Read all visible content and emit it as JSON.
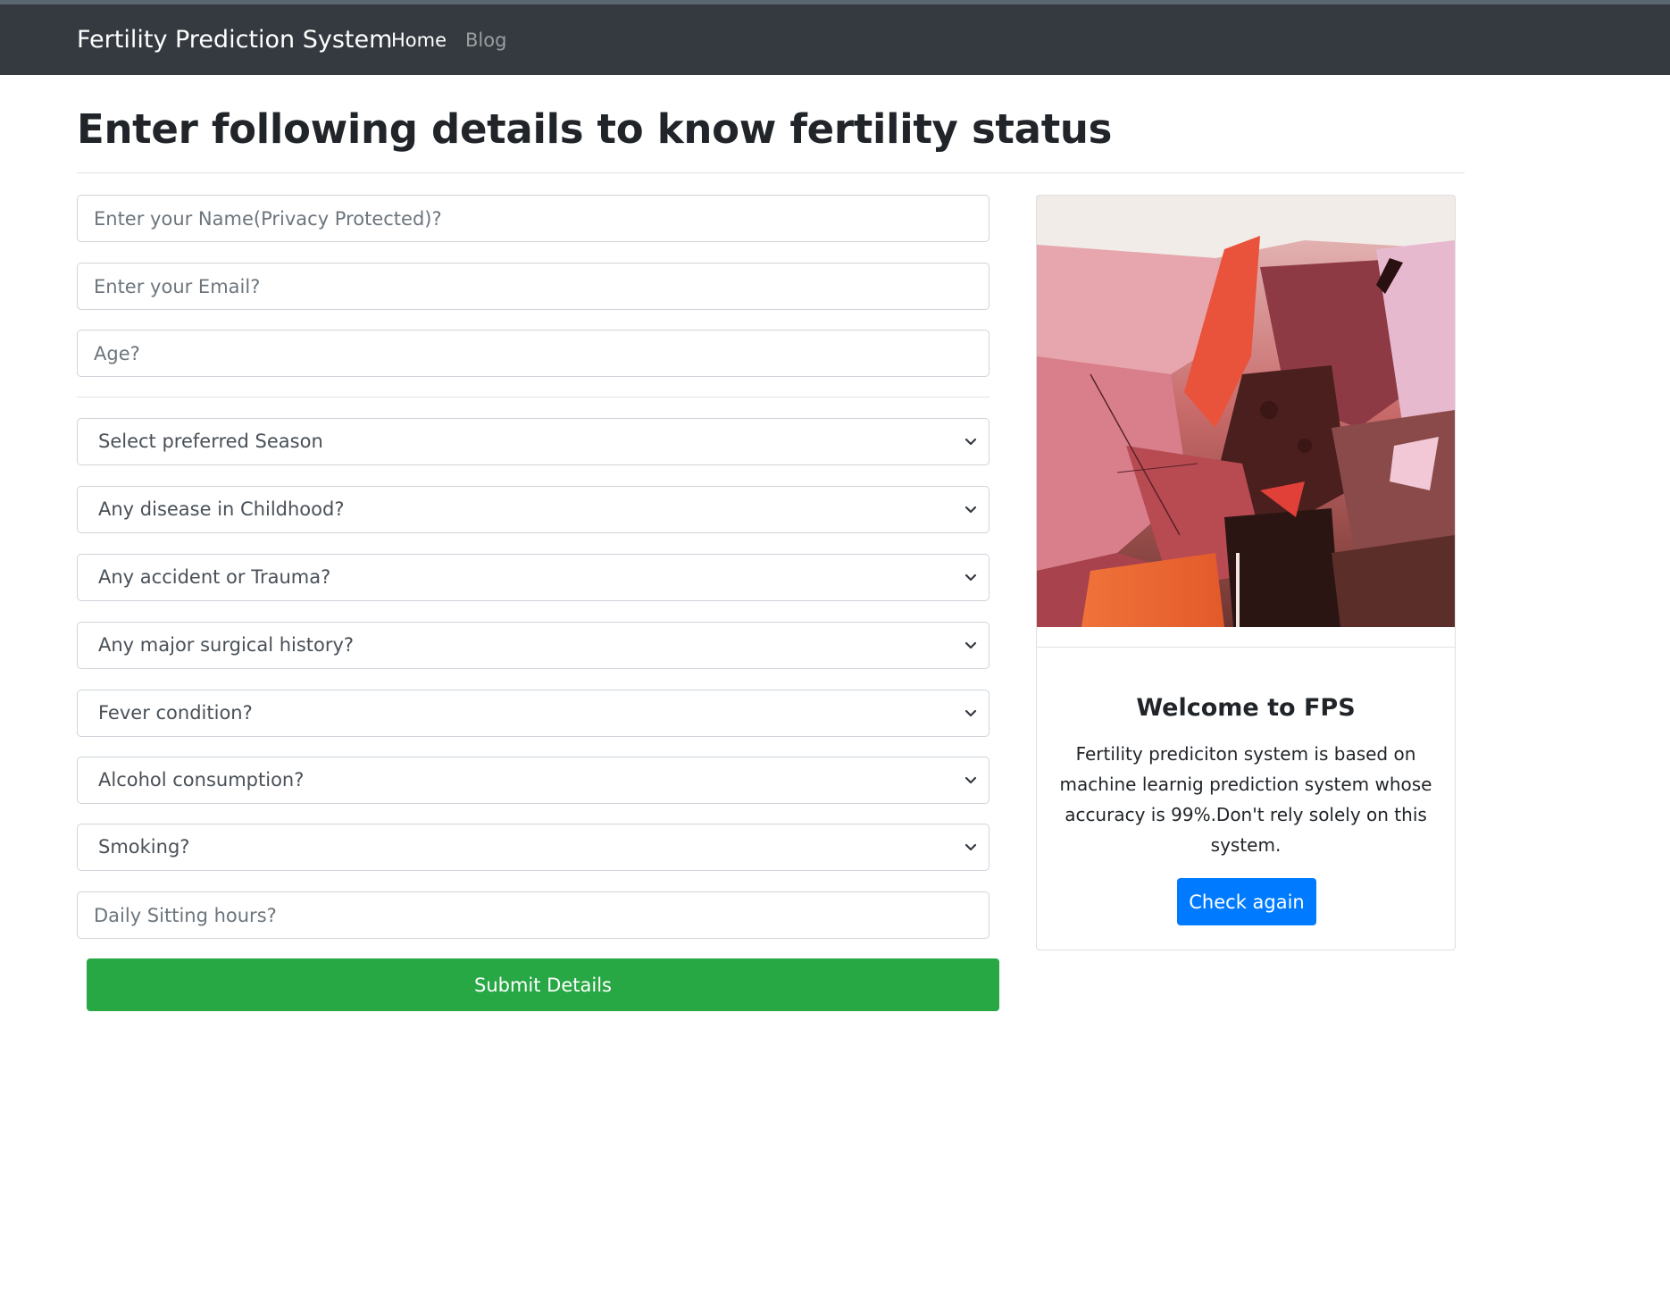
{
  "navbar": {
    "brand": "Fertility Prediction System",
    "links": [
      {
        "label": "Home"
      },
      {
        "label": "Blog"
      }
    ]
  },
  "page": {
    "heading": "Enter following details to know fertility status"
  },
  "form": {
    "name_placeholder": "Enter your Name(Privacy Protected)?",
    "email_placeholder": "Enter your Email?",
    "age_placeholder": "Age?",
    "selects": [
      {
        "label": "Select preferred Season"
      },
      {
        "label": "Any disease in Childhood?"
      },
      {
        "label": "Any accident or Trauma?"
      },
      {
        "label": "Any major surgical history?"
      },
      {
        "label": "Fever condition?"
      },
      {
        "label": "Alcohol consumption?"
      },
      {
        "label": "Smoking?"
      }
    ],
    "sitting_placeholder": "Daily Sitting hours?",
    "submit_label": "Submit Details"
  },
  "card": {
    "title": "Welcome to FPS",
    "text": "Fertility prediciton system is based on machine learnig prediction system whose accuracy is 99%.Don't rely solely on this system.",
    "button_label": "Check again",
    "image_icon": "abstract-painting-image"
  },
  "colors": {
    "navbar_bg": "#343a40",
    "submit_green": "#28a745",
    "check_blue": "#007bff"
  }
}
